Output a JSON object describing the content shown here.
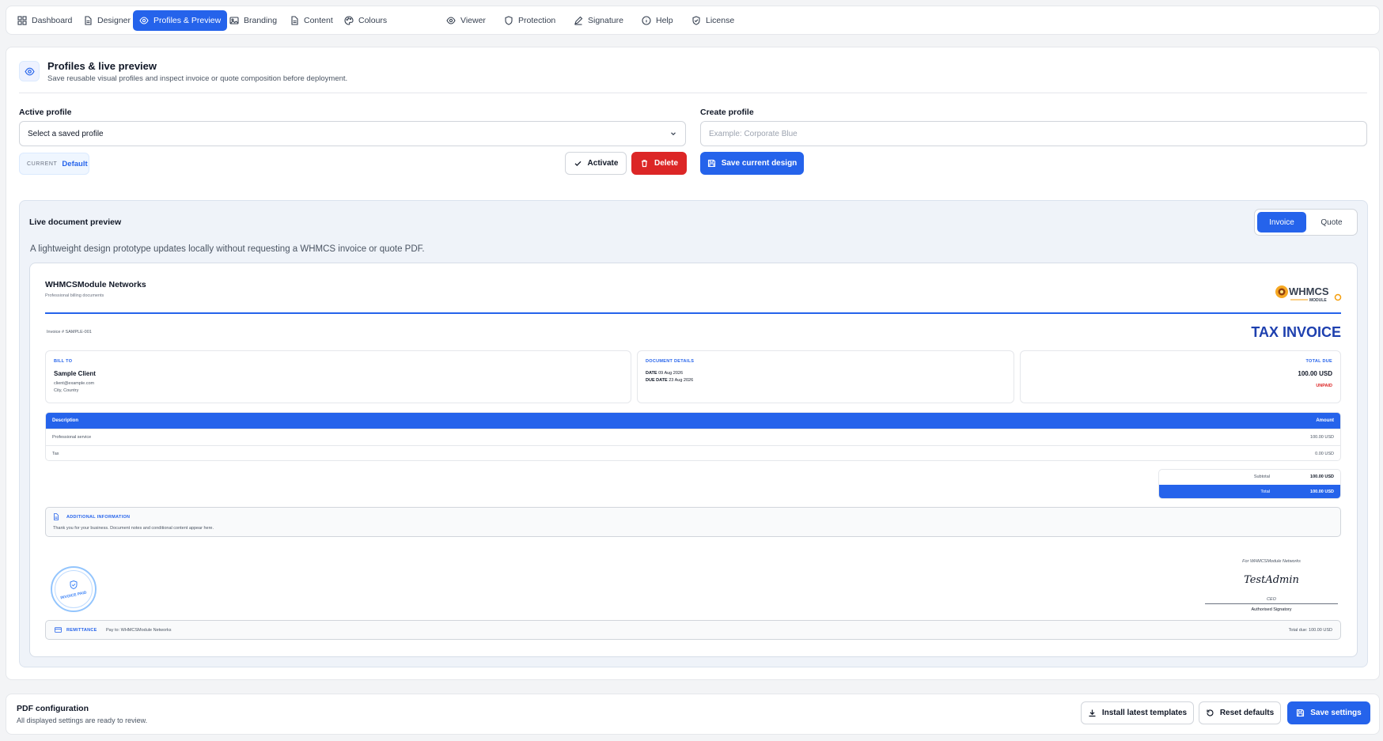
{
  "nav": [
    {
      "label": "Dashboard",
      "icon": "dashboard-icon"
    },
    {
      "label": "Designer",
      "icon": "document-icon"
    },
    {
      "label": "Profiles & Preview",
      "icon": "eye-icon",
      "active": true
    },
    {
      "label": "Branding",
      "icon": "image-icon"
    },
    {
      "label": "Content",
      "icon": "document-icon"
    },
    {
      "label": "Colours",
      "icon": "palette-icon"
    },
    {
      "label": "Viewer",
      "icon": "eye-icon"
    },
    {
      "label": "Protection",
      "icon": "shield-icon"
    },
    {
      "label": "Signature",
      "icon": "pen-icon"
    },
    {
      "label": "Help",
      "icon": "info-icon"
    },
    {
      "label": "License",
      "icon": "shield-check-icon"
    }
  ],
  "header": {
    "title": "Profiles & live preview",
    "subtitle": "Save reusable visual profiles and inspect invoice or quote composition before deployment."
  },
  "active_profile": {
    "label": "Active profile",
    "select_value": "Select a saved profile",
    "current_key": "CURRENT",
    "current_value": "Default",
    "activate_label": "Activate",
    "delete_label": "Delete"
  },
  "create_profile": {
    "label": "Create profile",
    "placeholder": "Example: Corporate Blue",
    "save_label": "Save current design"
  },
  "preview": {
    "title": "Live document preview",
    "tabs": [
      "Invoice",
      "Quote"
    ],
    "active_tab": "Invoice",
    "description": "A lightweight design prototype updates locally without requesting a WHMCS invoice or quote PDF."
  },
  "document": {
    "company": "WHMCSModule Networks",
    "tagline": "Professional billing documents",
    "logo_text": "WHMCS",
    "logo_sub": "MODULE",
    "invoice_no": "Invoice # SAMPLE-001",
    "doc_title": "TAX INVOICE",
    "bill_to": {
      "caption": "BILL TO",
      "name": "Sample Client",
      "email": "client@example.com",
      "location": "City, Country"
    },
    "details": {
      "caption": "DOCUMENT DETAILS",
      "date_key": "DATE",
      "date": "09 Aug 2026",
      "due_key": "DUE DATE",
      "due": "23 Aug 2026"
    },
    "total_due": {
      "caption": "TOTAL DUE",
      "amount": "100.00 USD",
      "status": "UNPAID"
    },
    "table": {
      "headers": [
        "Description",
        "Amount"
      ],
      "rows": [
        {
          "desc": "Professional service",
          "amount": "100.00 USD"
        },
        {
          "desc": "Tax",
          "amount": "0.00 USD"
        }
      ]
    },
    "totals": [
      {
        "label": "Subtotal",
        "value": "100.00 USD"
      },
      {
        "label": "Total",
        "value": "100.00 USD"
      }
    ],
    "additional": {
      "caption": "ADDITIONAL INFORMATION",
      "text": "Thank you for your business. Document notes and conditional content appear here."
    },
    "stamp_text": "INVOICE PAID",
    "signature": {
      "for_line": "For WHMCSModule Networks",
      "name": "TestAdmin",
      "role": "CEO",
      "label": "Authorised Signatory"
    },
    "remittance": {
      "caption": "REMITTANCE",
      "pay_to": "Pay to: WHMCSModule Networks",
      "total_due": "Total due: 100.00 USD"
    }
  },
  "footer": {
    "title": "PDF configuration",
    "subtitle": "All displayed settings are ready to review.",
    "install_label": "Install latest templates",
    "reset_label": "Reset defaults",
    "save_label": "Save settings"
  },
  "colors": {
    "accent": "#2563eb",
    "danger": "#dc2626",
    "title_blue": "#1e40af"
  }
}
